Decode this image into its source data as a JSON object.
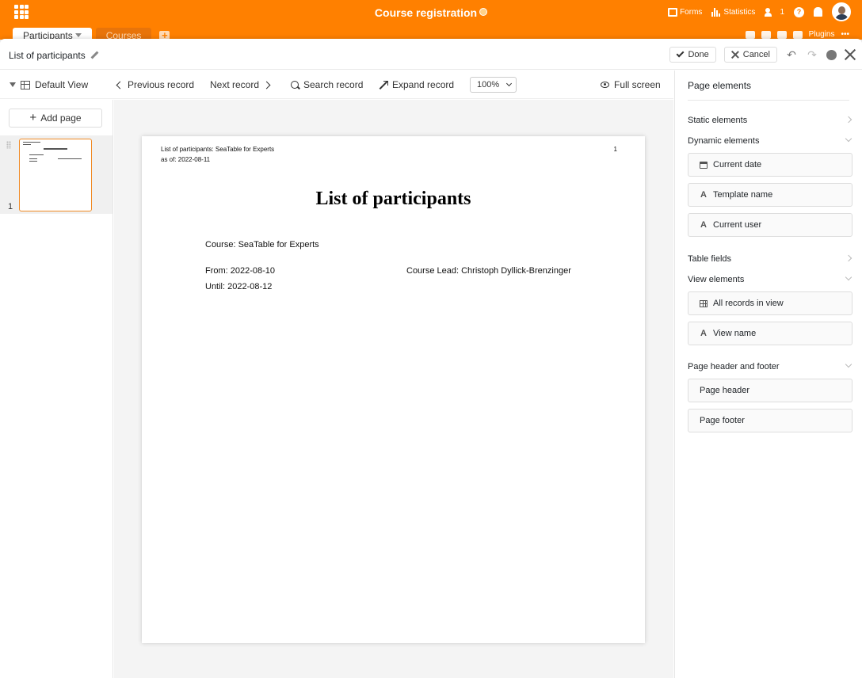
{
  "app": {
    "base_title": "Course registration",
    "tools": {
      "forms": "Forms",
      "statistics": "Statistics",
      "collaborators_count": "1",
      "plugins": "Plugins"
    }
  },
  "tabs": [
    {
      "label": "Participants"
    },
    {
      "label": "Courses"
    }
  ],
  "modal": {
    "title": "List of participants",
    "done_label": "Done",
    "cancel_label": "Cancel"
  },
  "toolbar": {
    "view": "Default View",
    "previous": "Previous record",
    "next": "Next record",
    "search": "Search record",
    "expand": "Expand record",
    "zoom": "100%",
    "fullscreen": "Full screen"
  },
  "pages": {
    "add_page": "Add page",
    "items": [
      {
        "number": "1"
      }
    ]
  },
  "document": {
    "header_title": "List of participants: SeaTable for Experts",
    "header_date": "as of:   2022-08-11",
    "page_number": "1",
    "title": "List of participants",
    "course": "Course: SeaTable for Experts",
    "from": "From: 2022-08-10",
    "until": "Until: 2022-08-12",
    "course_lead": "Course Lead: Christoph Dyllick-Brenzinger"
  },
  "panel": {
    "title": "Page elements",
    "static_elements": "Static elements",
    "dynamic_elements": "Dynamic elements",
    "dynamic_items": [
      "Current date",
      "Template name",
      "Current user"
    ],
    "table_fields": "Table fields",
    "view_elements": "View elements",
    "view_items": [
      "All records in view",
      "View name"
    ],
    "header_footer": "Page header and footer",
    "header_footer_items": [
      "Page header",
      "Page footer"
    ]
  }
}
